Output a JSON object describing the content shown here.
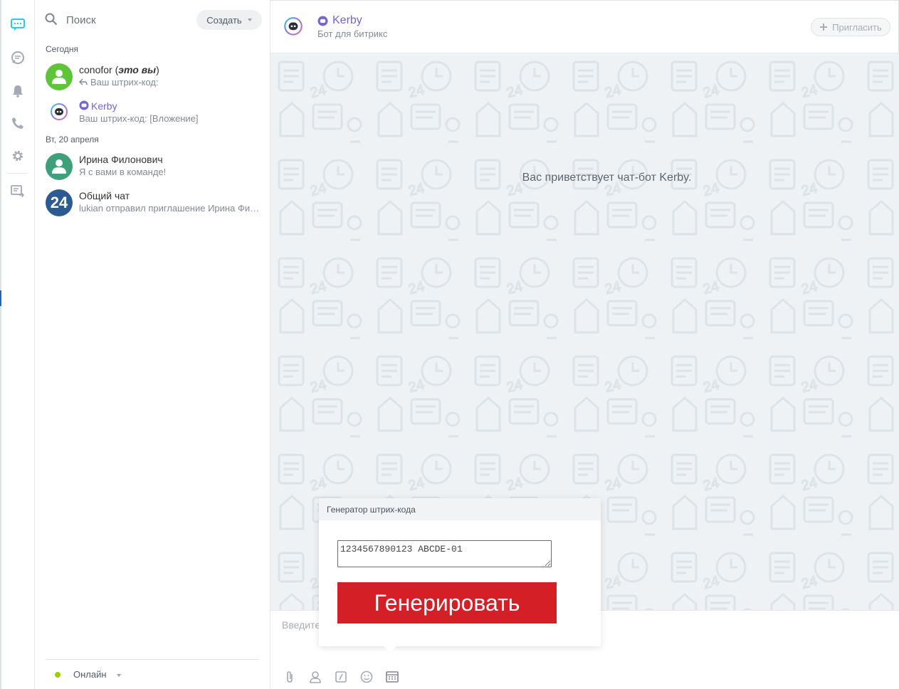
{
  "rail": {
    "items": [
      {
        "icon": "chat-icon",
        "active": true
      },
      {
        "icon": "open-lines-icon",
        "active": false
      },
      {
        "icon": "bell-icon",
        "active": false
      },
      {
        "icon": "phone-icon",
        "active": false
      },
      {
        "icon": "gear-icon",
        "active": false
      },
      {
        "icon": "export-icon",
        "active": false
      }
    ],
    "active_color": "#2fc6f6",
    "icon_color": "#a3aab3"
  },
  "recent": {
    "search_placeholder": "Поиск",
    "create_label": "Создать",
    "groups": [
      {
        "label": "Сегодня",
        "items": [
          {
            "title": "conofor",
            "title_suffix": "это вы",
            "subtitle": "Ваш штрих-код:",
            "reply": true,
            "avatar": "user-icon",
            "avatar_color": "#5ec53b"
          },
          {
            "title": "Kerby",
            "subtitle": "Ваш штрих-код: [Вложение]",
            "bot": true,
            "avatar": "bot-avatar"
          }
        ]
      },
      {
        "label": "Вт, 20 апреля",
        "items": [
          {
            "title": "Ирина Филонович",
            "subtitle": "Я с вами в команде!",
            "avatar": "user-icon",
            "avatar_color": "#3e9f7a"
          },
          {
            "title": "Общий чат",
            "subtitle": "lukian отправил приглашение Ирина Филонович",
            "avatar": "24-icon",
            "avatar_color": "#2c5b91",
            "avatar_text": "24"
          }
        ]
      }
    ],
    "status_label": "Онлайн",
    "status_color": "#9dcf00"
  },
  "chat": {
    "title": "Kerby",
    "subtitle": "Бот для битрикс",
    "invite_label": "Пригласить",
    "welcome": "Вас приветствует чат-бот Kerby.",
    "input_placeholder": "Введите сообщение",
    "tools": [
      "paperclip-icon",
      "user-icon",
      "command-icon",
      "smile-icon",
      "keyboard-icon"
    ],
    "bot_color": "#7664d3"
  },
  "popup": {
    "title": "Генератор штрих-кода",
    "textarea_value": "1234567890123 ABCDE-01",
    "button_label": "Генерировать",
    "button_color": "#d41f26"
  }
}
